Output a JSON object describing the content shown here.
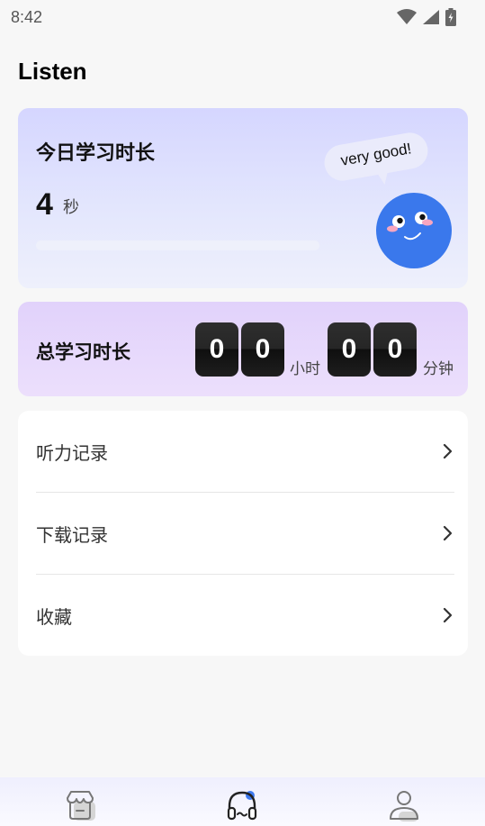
{
  "status_bar": {
    "time": "8:42"
  },
  "header": {
    "title": "Listen"
  },
  "today": {
    "title": "今日学习时长",
    "value": "4",
    "unit": "秒",
    "progress": 0,
    "bubble_text": "very good!"
  },
  "total": {
    "title": "总学习时长",
    "hours_digits": [
      "0",
      "0"
    ],
    "hours_unit": "小时",
    "minutes_digits": [
      "0",
      "0"
    ],
    "minutes_unit": "分钟"
  },
  "menu": {
    "items": [
      {
        "label": "听力记录"
      },
      {
        "label": "下载记录"
      },
      {
        "label": "收藏"
      }
    ]
  },
  "bottom_nav": {
    "items": [
      {
        "icon": "store-icon",
        "active": false
      },
      {
        "icon": "headphones-icon",
        "active": true
      },
      {
        "icon": "profile-icon",
        "active": false
      }
    ]
  },
  "colors": {
    "accent": "#3f7bf0",
    "today_card_bg": "#d5d6ff",
    "total_card_bg": "#e4d6fb",
    "flip_digit_bg": "#222222"
  }
}
